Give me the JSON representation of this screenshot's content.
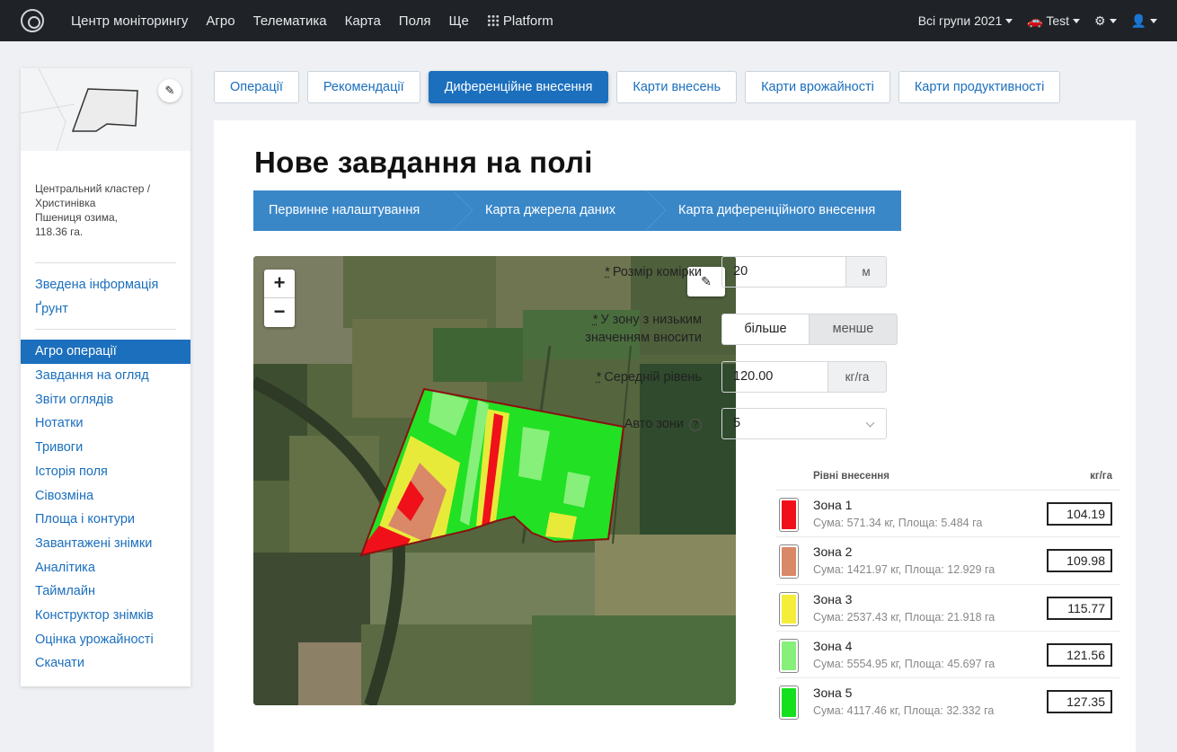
{
  "nav": {
    "items": [
      "Центр моніторингу",
      "Агро",
      "Телематика",
      "Карта",
      "Поля",
      "Ще",
      "Platform"
    ],
    "groups": "Всі групи 2021",
    "user": "Test"
  },
  "sidebar": {
    "field_info": [
      "Центральний кластер /",
      "Христинівка",
      "Пшениця озима,",
      "118.36 га."
    ],
    "links_top": [
      "Зведена інформація",
      "Ґрунт"
    ],
    "links": [
      "Агро операції",
      "Завдання на огляд",
      "Звіти оглядів",
      "Нотатки",
      "Тривоги",
      "Історія поля",
      "Сівозміна",
      "Площа і контури",
      "Завантажені знімки",
      "Аналітика",
      "Таймлайн",
      "Конструктор знімків",
      "Оцінка урожайності",
      "Скачати"
    ],
    "active_link": "Агро операції"
  },
  "tabs": [
    "Операції",
    "Рекомендації",
    "Диференційне внесення",
    "Карти внесень",
    "Карти врожайності",
    "Карти продуктивності"
  ],
  "active_tab": "Диференційне внесення",
  "page_title": "Нове завдання на полі",
  "steps": [
    "Первинне налаштування",
    "Карта джерела даних",
    "Карта диференційного внесення"
  ],
  "map": {
    "zoom_in": "+",
    "zoom_out": "−"
  },
  "form": {
    "cell_size": {
      "label": "Розмір комірки",
      "value": "20",
      "unit": "м"
    },
    "low_zone": {
      "label_1": "У зону з низьким",
      "label_2": "значенням вносити",
      "opt_more": "більше",
      "opt_less": "менше",
      "selected": "більше"
    },
    "avg_level": {
      "label": "Середній рівень",
      "value": "120.00",
      "unit": "кг/га"
    },
    "auto_zones": {
      "label": "Авто зони",
      "value": "5"
    }
  },
  "zones": {
    "header_left": "Рівні внесення",
    "header_right": "кг/га",
    "rows": [
      {
        "name": "Зона 1",
        "sub": "Сума: 571.34 кг, Площа: 5.484 га",
        "value": "104.19",
        "color": "#f0101a"
      },
      {
        "name": "Зона 2",
        "sub": "Сума: 1421.97 кг, Площа: 12.929 га",
        "value": "109.98",
        "color": "#d98868"
      },
      {
        "name": "Зона 3",
        "sub": "Сума: 2537.43 кг, Площа: 21.918 га",
        "value": "115.77",
        "color": "#f4ee3a"
      },
      {
        "name": "Зона 4",
        "sub": "Сума: 5554.95 кг, Площа: 45.697 га",
        "value": "121.56",
        "color": "#86f07a"
      },
      {
        "name": "Зона 5",
        "sub": "Сума: 4117.46 кг, Площа: 32.332 га",
        "value": "127.35",
        "color": "#16e01e"
      }
    ]
  }
}
